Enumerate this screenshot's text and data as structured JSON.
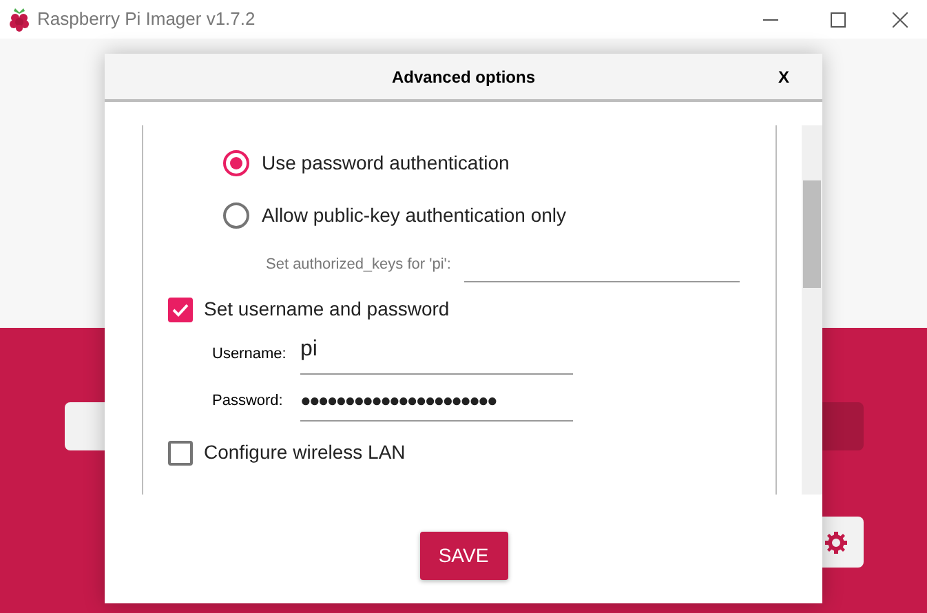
{
  "window": {
    "title": "Raspberry Pi Imager v1.7.2"
  },
  "dialog": {
    "title": "Advanced options",
    "close_label": "X",
    "auth_options": [
      {
        "label": "Use password authentication",
        "selected": true
      },
      {
        "label": "Allow public-key authentication only",
        "selected": false
      }
    ],
    "authorized_keys_label": "Set authorized_keys for 'pi':",
    "user_option": {
      "label": "Set username and password",
      "checked": true
    },
    "username": {
      "label": "Username:",
      "value": "pi"
    },
    "password": {
      "label": "Password:",
      "value": "●●●●●●●●●●●●●●●●●●●●●●"
    },
    "wifi_option": {
      "label": "Configure wireless LAN",
      "checked": false
    },
    "save_button": "SAVE"
  }
}
